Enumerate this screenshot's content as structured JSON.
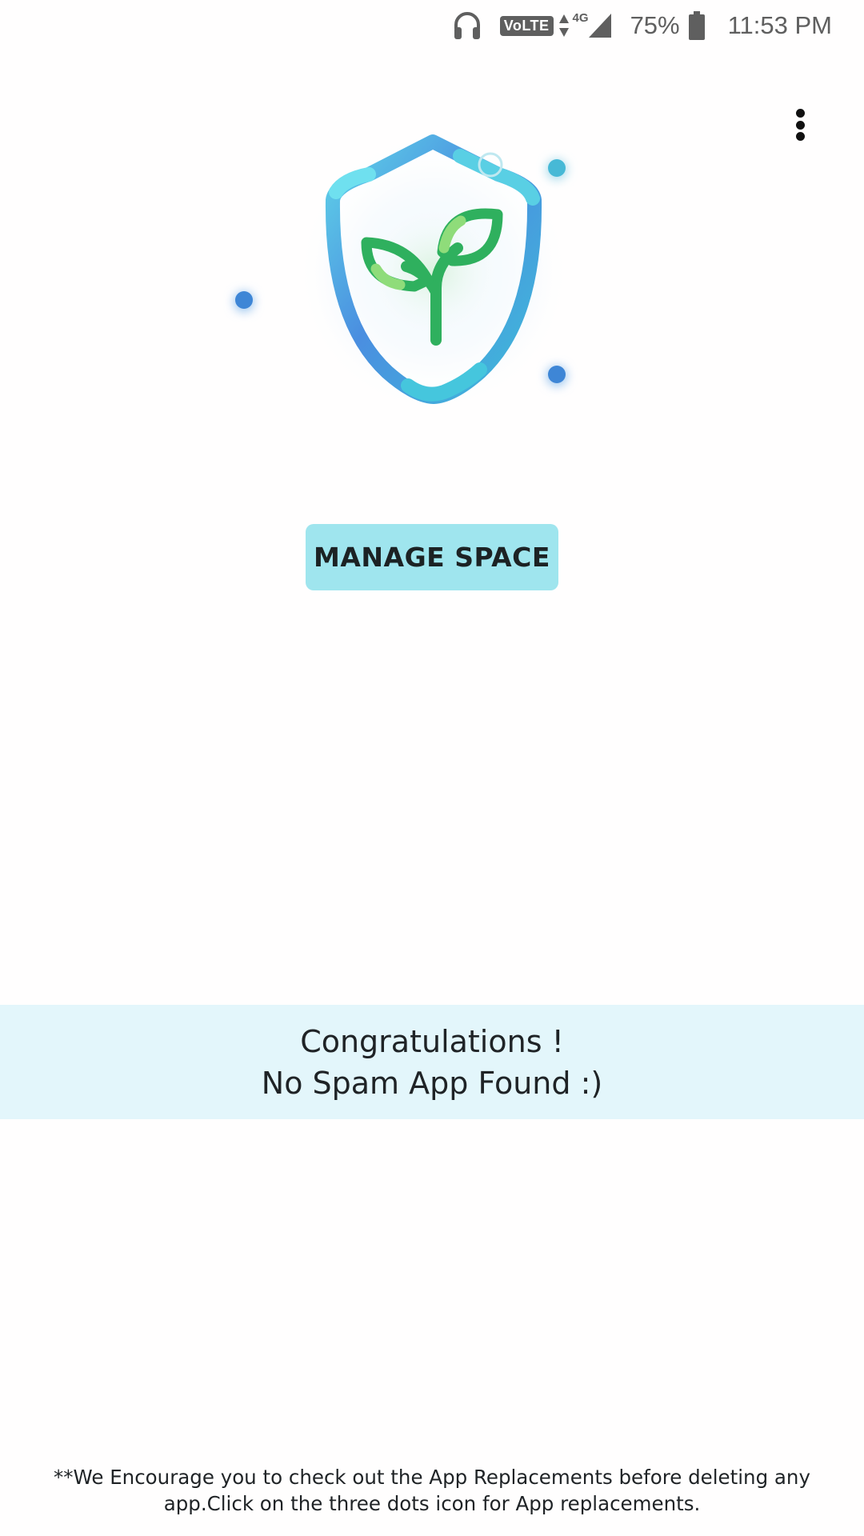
{
  "status_bar": {
    "volte": "VoLTE",
    "network": "4G",
    "battery_percent": "75%",
    "time": "11:53 PM",
    "icons": [
      "headphones-icon",
      "data-arrows-icon",
      "signal-icon",
      "battery-icon"
    ]
  },
  "toolbar": {
    "menu_icon": "more-vert-icon"
  },
  "hero": {
    "icon": "shield-sprout-icon",
    "colors": {
      "shield_blue": "#4a86db",
      "shield_cyan": "#5fd0e6",
      "leaf_green": "#2fb05e",
      "leaf_light": "#8fdc7a"
    }
  },
  "actions": {
    "manage_space_label": "MANAGE SPACE"
  },
  "result": {
    "line1": "Congratulations !",
    "line2": "No Spam App Found :)"
  },
  "footer": {
    "note": "**We Encourage you to check out the App Replacements before deleting any app.Click on the three dots icon for App replacements."
  }
}
